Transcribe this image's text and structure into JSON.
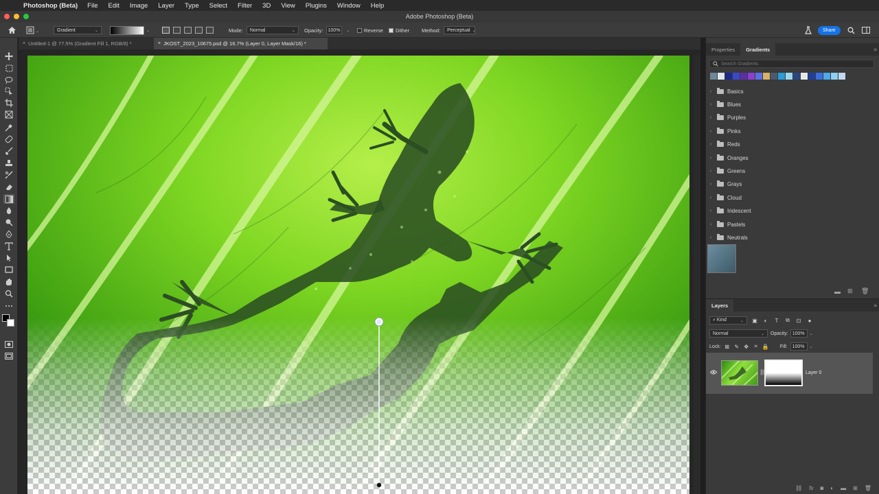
{
  "menubar": {
    "app_name": "Photoshop (Beta)",
    "items": [
      "File",
      "Edit",
      "Image",
      "Layer",
      "Type",
      "Select",
      "Filter",
      "3D",
      "View",
      "Plugins",
      "Window",
      "Help"
    ]
  },
  "titlebar": {
    "title": "Adobe Photoshop (Beta)"
  },
  "options": {
    "tool_preset": "Gradient",
    "mode_label": "Mode:",
    "mode_value": "Normal",
    "opacity_label": "Opacity:",
    "opacity_value": "100%",
    "reverse_label": "Reverse",
    "reverse_checked": false,
    "dither_label": "Dither",
    "dither_checked": true,
    "method_label": "Method:",
    "method_value": "Perceptual",
    "share_label": "Share"
  },
  "tabs": [
    {
      "label": "Untitled-1 @ 77.5% (Gradient Fill 1, RGB/8) *",
      "active": false
    },
    {
      "label": "JKOST_2023_10675.psd @ 16.7% (Layer 0, Layer Mask/16) *",
      "active": true
    }
  ],
  "gradients_panel": {
    "tabs": [
      "Properties",
      "Gradients"
    ],
    "active_tab": "Gradients",
    "search_placeholder": "Search Gradients",
    "swatch_colors": [
      "#6f8899",
      "#dfe6ee",
      "#1b2a8a",
      "#3a48c6",
      "#5a2fa8",
      "#8a3fd0",
      "#5a6fe0",
      "#d8b068",
      "#4a5a70",
      "#2c9bd6",
      "#9bd8ee",
      "#2b4480",
      "#e8e8e8",
      "#1f3fa0",
      "#3a6ee0",
      "#4fa8e8",
      "#8ed0f0",
      "#c0d8f0"
    ],
    "folders": [
      "Basics",
      "Blues",
      "Purples",
      "Pinks",
      "Reds",
      "Oranges",
      "Greens",
      "Grays",
      "Cloud",
      "Iridescent",
      "Pastels",
      "Neutrals"
    ]
  },
  "layers_panel": {
    "title": "Layers",
    "filter_kind": "Kind",
    "blend_mode": "Normal",
    "opacity_label": "Opacity:",
    "opacity_value": "100%",
    "lock_label": "Lock:",
    "fill_label": "Fill:",
    "fill_value": "100%",
    "layers": [
      {
        "name": "Layer 0",
        "visible": true,
        "has_mask": true
      }
    ]
  },
  "colors": {
    "accent_blue": "#1473e6",
    "leaf_green": "#6fd219",
    "panel_bg": "#3a3a3a"
  }
}
